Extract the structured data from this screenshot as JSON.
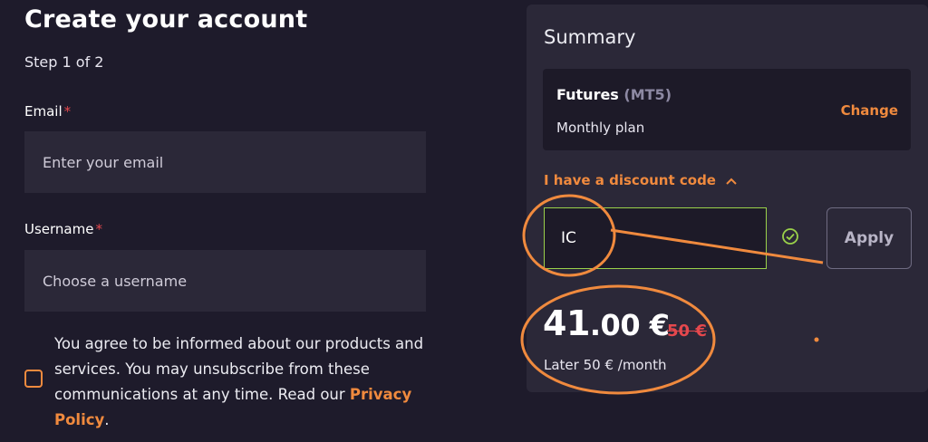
{
  "form": {
    "title": "Create your account",
    "step": "Step 1 of 2",
    "email": {
      "label": "Email",
      "required_mark": "*",
      "placeholder": "Enter your email",
      "value": ""
    },
    "username": {
      "label": "Username",
      "required_mark": "*",
      "placeholder": "Choose a username",
      "value": ""
    },
    "consent": {
      "checked": false,
      "text": "You agree to be informed about our products and services. You may unsubscribe from these communications at any time. Read our",
      "link_label": "Privacy Policy",
      "end": "."
    }
  },
  "summary": {
    "title": "Summary",
    "plan": {
      "name": "Futures",
      "type": "(MT5)",
      "period": "Monthly plan",
      "change_label": "Change"
    },
    "discount": {
      "toggle_label": "I have a discount code",
      "toggle_icon": "chevron-up-icon",
      "code_value": "IC",
      "valid": true,
      "apply_label": "Apply"
    },
    "price": {
      "integer": "41",
      "decimal": ".00 €",
      "original": "50 €",
      "later_text": "Later 50 € /month"
    }
  },
  "colors": {
    "accent": "#f08a3e",
    "error": "#e5484d",
    "valid": "#9ad14a",
    "background": "#1e1b2b",
    "panel": "#2b2838"
  }
}
